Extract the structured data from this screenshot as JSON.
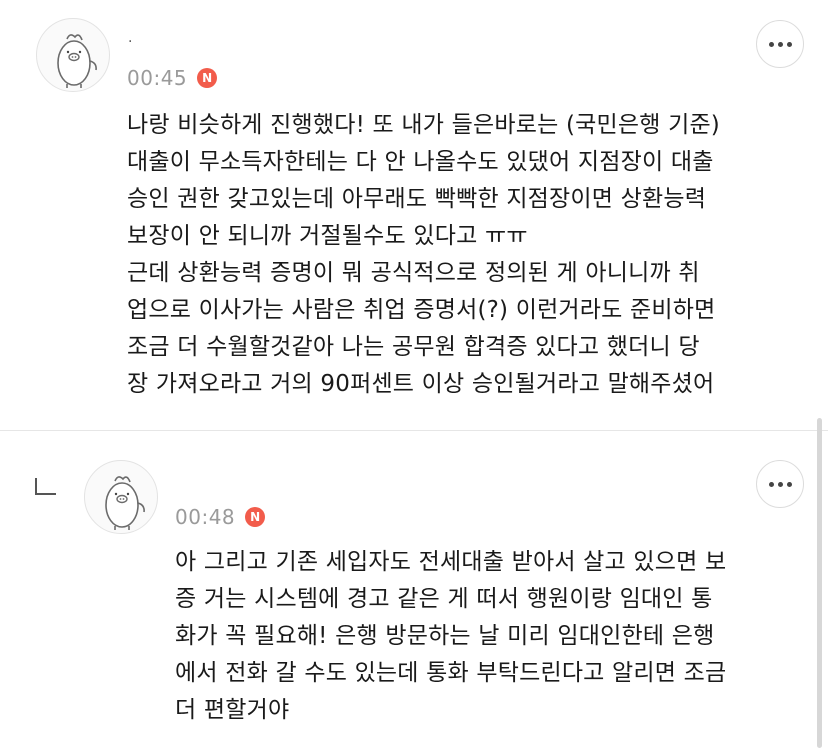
{
  "comments": [
    {
      "author": ".",
      "time": "00:45",
      "badge": "N",
      "text": "나랑 비슷하게 진행했다! 또 내가 들은바로는 (국민은행 기준)\n대출이 무소득자한테는 다 안 나올수도 있댔어 지점장이 대출\n승인 권한 갖고있는데 아무래도 빡빡한 지점장이면 상환능력\n보장이 안 되니까 거절될수도 있다고 ㅠㅠ\n근데 상환능력 증명이 뭐 공식적으로 정의된 게 아니니까 취\n업으로 이사가는 사람은 취업 증명서(?) 이런거라도 준비하면\n조금 더 수월할것같아 나는 공무원 합격증 있다고 했더니 당\n장 가져오라고 거의 90퍼센트 이상 승인될거라고 말해주셨어"
    },
    {
      "author": "",
      "time": "00:48",
      "badge": "N",
      "text": "아 그리고 기존 세입자도 전세대출 받아서 살고 있으면 보\n증 거는 시스템에 경고 같은 게 떠서 행원이랑 임대인 통\n화가 꼭 필요해! 은행 방문하는 날 미리 임대인한테 은행\n에서 전화 갈 수도 있는데 통화 부탁드린다고 알리면 조금\n더 편할거야"
    }
  ],
  "colors": {
    "badge": "#f25c4b",
    "time": "#9a9a9a",
    "divider": "#e6e6e6"
  },
  "icons": {
    "avatar": "pig-mascot-avatar",
    "more": "more-dots-icon",
    "reply": "reply-arrow-icon"
  }
}
